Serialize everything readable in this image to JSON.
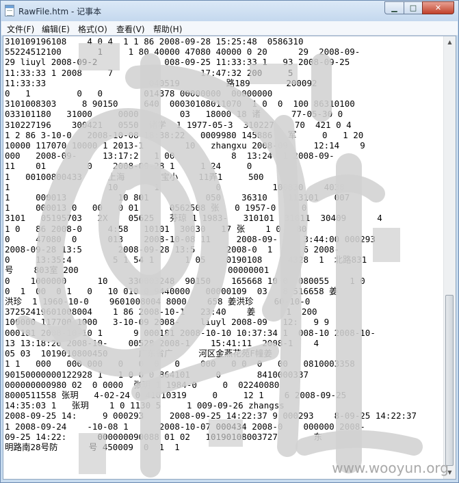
{
  "window": {
    "title": "RawFile.htm - 记事本",
    "minimize_icon": "minimize-icon",
    "maximize_icon": "maximize-icon",
    "close_icon": "close-icon"
  },
  "menu": {
    "items": [
      "文件(F)",
      "编辑(E)",
      "格式(O)",
      "查看(V)",
      "帮助(H)"
    ]
  },
  "editor": {
    "lines": [
      "310109196108    4 0 4  1 1 86 2008-09-28 15:25:48  0586310       ",
      "55224512100       1     1 80 40000 47080 40000 0 20      29  2008-09-",
      "29 liuyl 2008-09-2             008-09-25 11:33:33 1   93 2008-09-25 ",
      "11:33:33 1 2008     7                 17:47:32 200     5   ",
      "11:33:33                    040519         路189       200092   ",
      "0   1         0   0        014378 00000000  00000000     ",
      "3101008303     8 90150     640  00030108011070  1 0  0  100 86310100 ",
      "033101180   31000     0000        03   18000 18 诸      77-05-30 0 ",
      "310227196    300421   0550  诸学  1 1977-05-3  310227    70  421 0 4  ",
      "1 2 86 3-10-0   2008-10-08 18:38:22   0009980 145886   军     0   1 20 ",
      "10000 117070 10000 1 2013-1        10   zhangxu 2008-09     12:14    9",
      "000   2008-09-     13:17:2   1 00           8  13:24  1 2008-09-     ",
      "11    01        0    2008-09-28 1     1 24     0       ",
      "1   00100800433     上海       宝小    11弄1     500     ",
      "1                   10       1           0          100830    4038 ",
      "1     000013          10 801           050    36310    113101   007 ",
      "1     000013 0   00   0 01      0562508 张   0 1957-0     0 ",
      "3101   05195703   2X    05625   芬琼 1 1983-   310101  31011  30409      4   ",
      "1 0   86 2008-0     4:58   10101  30030   17 张    1 0   80 ",
      "0     47080  0      013    2008-10-08 11     2008-09-     3:44:00 000293 ",
      "2008-09-28 13:5       2008-09-28 13:5      2008-0  1      6 2008-",
      "0     13:35:4        5 1 54 1      1 05    0190108     4328  1  北路831",
      "号    803室 200                             00000001   ",
      "0    1000000      10    330003248  90150    165668 10 0  080055    1 0 ",
      "0  1  00  0 1   0   10 010 0 9440000   00000109  03   8 516658 姜",
      "洪珍  1 1960-10-0    9601008004 8000    658 姜洪珍    60-10-0   ",
      "37252419601008004    1 86 2008-10-1   23:40    姜      1  200 ",
      "100000 117700 1000   3-10-09 2008-    liuyl 2008-09   12:   9 9 ",
      "000181 2008-10-10 1      9 000181 2008-10-10 10:37:34 1  008-10 2008-10-",
      "13 13:18:26 2008-10-    00528 2008-1    15:41:11  2008-1    4 ",
      "05 03  1019010800450      广东省广     河区金燕花苑F幢姜      ",
      "1 1   000   000 000   0   0  0   0    000   0 0  0   00   0810003358 ",
      "90150000000122928 1   1 0 0 0 864101     0       8410000337 ",
      "000000000980 02  0 0000  张玥 1 1984-0     0  02240080 ",
      "8000511558 张玥   4-02-24 0 41010319     0     12 1    6 2008-09-25 ",
      "14:35:03 1   张玥    1 0 1130 5     1 009-09-26 zhangss ",
      "2008-09-25 14:     9 000293     2008-09-25 14:22:37 9 000293    8-09-25 14:22:37 ",
      "1 2008-09-24    -10-08 1      2008-10-07 000434 2008-0    000000 2008-",
      "09-25 14:22:      000000090088 01 02   10190108003727       东",
      "明路南28号防      号 450009  0  1  1   "
    ]
  },
  "watermark": "www.wooyun.org"
}
